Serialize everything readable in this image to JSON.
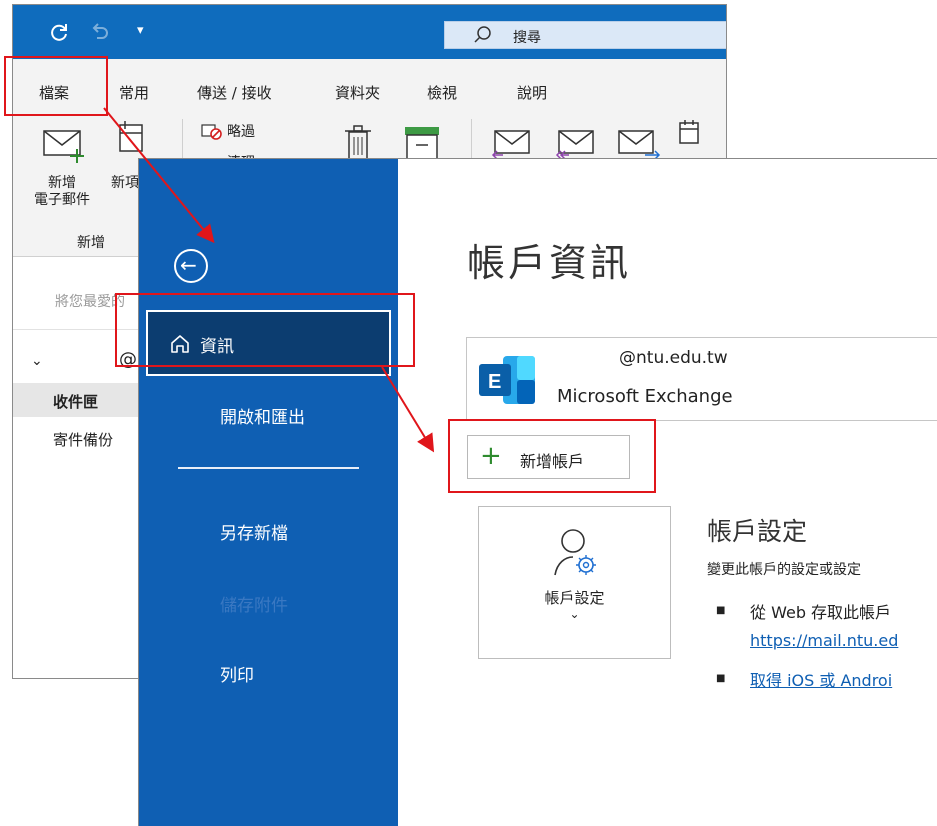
{
  "quick_access": {
    "search_placeholder": "搜尋"
  },
  "ribbon": {
    "tabs": [
      {
        "label": "檔案"
      },
      {
        "label": "常用"
      },
      {
        "label": "傳送 / 接收"
      },
      {
        "label": "資料夾"
      },
      {
        "label": "檢視"
      },
      {
        "label": "說明"
      }
    ],
    "new_email_line1": "新增",
    "new_email_line2": "電子郵件",
    "new_items_partial": "新項",
    "ignore_label": "略過",
    "cleanup_partial": "清理",
    "group_new": "新增"
  },
  "folder_pane": {
    "favorites_hint": "將您最愛的",
    "account_prefix": "@",
    "inbox": "收件匣",
    "sent_backup": "寄件備份"
  },
  "backstage": {
    "nav": {
      "info": "資訊",
      "open_export": "開啟和匯出",
      "save_as": "另存新檔",
      "save_attachments": "儲存附件",
      "print": "列印"
    },
    "page_title": "帳戶資訊",
    "account": {
      "email": "@ntu.edu.tw",
      "type": "Microsoft Exchange"
    },
    "add_account": "新增帳戶",
    "settings_tile": {
      "label": "帳戶設定",
      "chevron": "⌄"
    },
    "settings_heading": "帳戶設定",
    "settings_desc": "變更此帳戶的設定或設定",
    "bullets": [
      {
        "text": "從 Web 存取此帳戶",
        "link": "https://mail.ntu.ed"
      },
      {
        "link": "取得 iOS 或 Androi"
      }
    ]
  },
  "colors": {
    "accent": "#0f6cbd",
    "nav_bg": "#0f5fb3",
    "nav_active": "#0c3d70",
    "annotation": "#e0161b"
  }
}
